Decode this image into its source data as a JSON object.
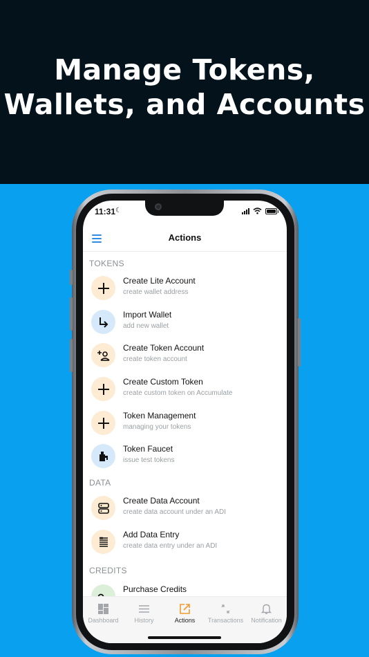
{
  "banner": {
    "line1": "Manage Tokens,",
    "line2": "Wallets, and Accounts"
  },
  "status_bar": {
    "time": "11:31",
    "moon": "☾"
  },
  "header": {
    "title": "Actions"
  },
  "sections": {
    "tokens": "TOKENS",
    "data": "DATA",
    "credits": "CREDITS"
  },
  "actions": [
    {
      "title": "Create Lite Account",
      "subtitle": "create wallet address",
      "icon": "plus-icon"
    },
    {
      "title": "Import Wallet",
      "subtitle": "add new wallet",
      "icon": "import-arrow-icon"
    },
    {
      "title": "Create Token Account",
      "subtitle": "create token account",
      "icon": "add-person-icon"
    },
    {
      "title": "Create Custom Token",
      "subtitle": "create custom token on Accumulate",
      "icon": "plus-icon"
    },
    {
      "title": "Token Management",
      "subtitle": "managing your tokens",
      "icon": "plus-icon"
    },
    {
      "title": "Token Faucet",
      "subtitle": "issue test tokens",
      "icon": "faucet-icon"
    },
    {
      "title": "Create Data Account",
      "subtitle": "create data account under an ADI",
      "icon": "database-icon"
    },
    {
      "title": "Add Data Entry",
      "subtitle": "create data entry under an ADI",
      "icon": "list-icon"
    },
    {
      "title": "Purchase Credits",
      "subtitle": "",
      "icon": "key-icon"
    }
  ],
  "nav": [
    {
      "label": "Dashboard",
      "icon": "dashboard-icon"
    },
    {
      "label": "History",
      "icon": "list-icon"
    },
    {
      "label": "Actions",
      "icon": "external-link-icon",
      "active": true
    },
    {
      "label": "Transactions",
      "icon": "arrows-icon"
    },
    {
      "label": "Notification",
      "icon": "bell-icon"
    }
  ],
  "colors": {
    "banner_bg": "#04131b",
    "page_bg": "#0aa0f0",
    "icon_bg_orange": "#fdebd3",
    "icon_bg_blue": "#d5e9fa",
    "icon_bg_green": "#dcefd8",
    "accent_blue": "#2f8be6",
    "accent_orange": "#f39a2b"
  }
}
